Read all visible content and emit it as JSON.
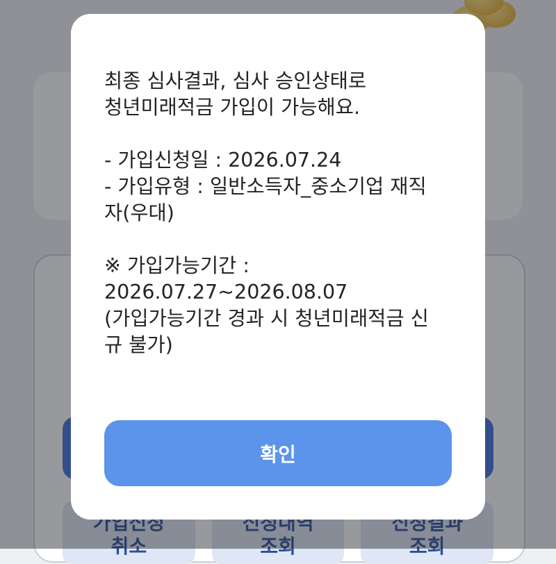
{
  "background": {
    "tiles": [
      {
        "line1": "가입신청",
        "line2": "취소"
      },
      {
        "line1": "신청내역",
        "line2": "조회"
      },
      {
        "line1": "신청결과",
        "line2": "조회"
      }
    ]
  },
  "dialog": {
    "message_lines": [
      "최종 심사결과, 심사 승인상태로",
      "청년미래적금 가입이 가능해요.",
      "",
      "- 가입신청일 : 2026.07.24",
      "- 가입유형 : 일반소득자_중소기업 재직",
      "자(우대)",
      "",
      "※ 가입가능기간 :",
      "2026.07.27~2026.08.07",
      "(가입가능기간 경과 시 청년미래적금 신",
      "규 불가)"
    ],
    "confirm_label": "확인"
  },
  "colors": {
    "confirm_button": "#5b94ea",
    "overlay": "#282a30",
    "text": "#222426"
  }
}
